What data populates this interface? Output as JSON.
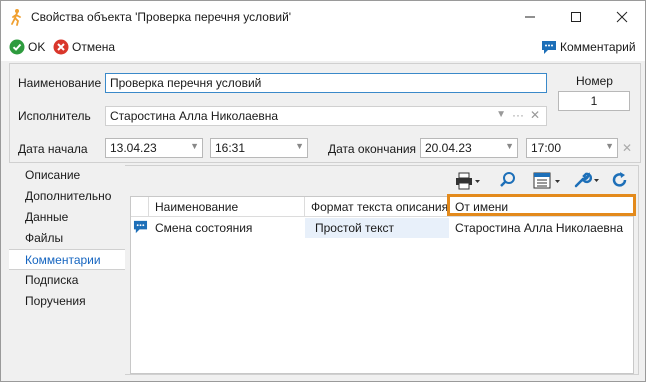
{
  "window": {
    "title": "Свойства объекта 'Проверка перечня условий'"
  },
  "toolbar": {
    "ok_label": "OK",
    "cancel_label": "Отмена",
    "comment_label": "Комментарий"
  },
  "form": {
    "name_label": "Наименование",
    "name_value": "Проверка перечня условий",
    "executor_label": "Исполнитель",
    "executor_value": "Старостина Алла Николаевна",
    "start_label": "Дата начала",
    "start_date": "13.04.23",
    "start_time": "16:31",
    "end_label": "Дата окончания",
    "end_date": "20.04.23",
    "end_time": "17:00",
    "number_label": "Номер",
    "number_value": "1"
  },
  "sidebar": {
    "items": [
      {
        "label": "Описание"
      },
      {
        "label": "Дополнительно"
      },
      {
        "label": "Данные"
      },
      {
        "label": "Файлы"
      },
      {
        "label": "Комментарии"
      },
      {
        "label": "Подписка"
      },
      {
        "label": "Поручения"
      }
    ],
    "active": "Комментарии"
  },
  "grid": {
    "columns": [
      "Наименование",
      "Формат текста описания",
      "От имени"
    ],
    "rows": [
      {
        "name": "Смена состояния",
        "format": "Простой текст",
        "author": "Старостина Алла Николаевна"
      }
    ]
  },
  "colors": {
    "accent": "#1565c0",
    "ok_green": "#2e9b3e",
    "cancel_red": "#d9362b",
    "highlight": "#e38a1c",
    "comment_blue": "#1d6fb8"
  }
}
